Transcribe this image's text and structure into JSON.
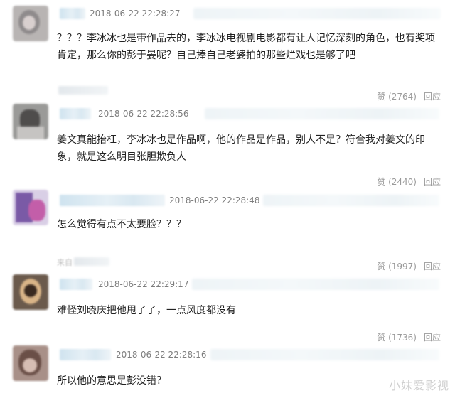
{
  "comments": [
    {
      "timestamp": "2018-06-22 22:28:27",
      "text": "？？？李冰冰也是带作品去的，李冰冰电视剧电影都有让人记忆深刻的角色，也有奖项肯定，那么你的彭于晏呢？自己捧自己老婆拍的那些烂戏也是够了吧",
      "source": "",
      "likes": "赞 (2764)",
      "reply": "回应"
    },
    {
      "timestamp": "2018-06-22 22:28:56",
      "text": "姜文真能抬杠，李冰冰也是作品啊，他的作品是作品，别人不是？符合我对姜文的印象，就是这么明目张胆欺负人",
      "source": "",
      "likes": "赞 (2440)",
      "reply": "回应"
    },
    {
      "timestamp": "2018-06-22 22:28:48",
      "text": "怎么觉得有点不太要脸？？？",
      "source": "来自",
      "likes": "赞 (1997)",
      "reply": "回应"
    },
    {
      "timestamp": "2018-06-22 22:29:17",
      "text": "难怪刘晓庆把他甩了了，一点风度都没有",
      "source": "",
      "likes": "赞 (1736)",
      "reply": "回应"
    },
    {
      "timestamp": "2018-06-22 22:28:16",
      "text": "所以他的意思是彭没错？",
      "source": "",
      "likes": "",
      "reply": ""
    }
  ],
  "watermark": "小妹爱影视",
  "colors": {
    "text": "#222222",
    "timestamp": "#7d7d7d",
    "action": "#9a9a9a",
    "username_blur": "#cfe3ef"
  }
}
